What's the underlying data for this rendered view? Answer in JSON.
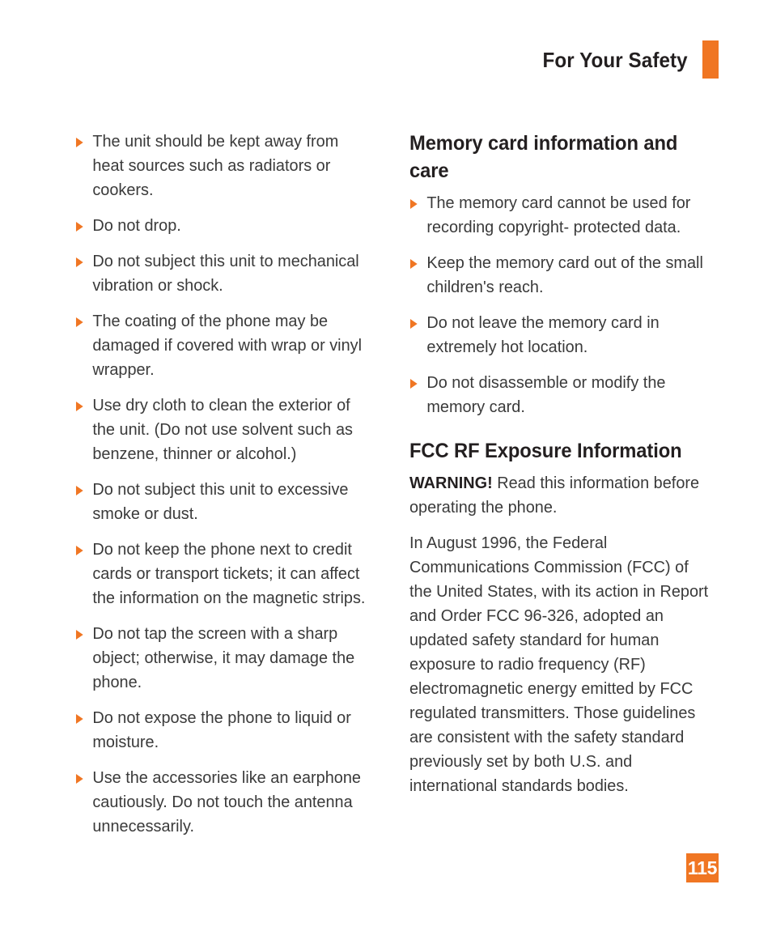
{
  "header": {
    "title": "For Your Safety",
    "accent_color": "#f07623"
  },
  "left_column": {
    "bullets": [
      "The unit should be kept away from heat sources such as radiators or cookers.",
      "Do not drop.",
      "Do not subject this unit to mechanical vibration or shock.",
      "The coating of the phone may be damaged if covered with wrap or vinyl wrapper.",
      "Use dry cloth to clean the exterior of the unit. (Do not use solvent such as benzene, thinner or alcohol.)",
      "Do not subject this unit to excessive smoke or dust.",
      "Do not keep the phone next to credit cards or transport tickets; it can affect the information on the magnetic strips.",
      "Do not tap the screen with a sharp object; otherwise, it may damage the phone.",
      "Do not expose the phone to liquid or moisture.",
      "Use the accessories like an earphone cautiously. Do not touch the antenna unnecessarily."
    ]
  },
  "right_column": {
    "memory_card": {
      "heading": "Memory card information and care",
      "bullets": [
        "The memory card cannot be used for recording copyright- protected data.",
        "Keep the memory card out of the small children's reach.",
        "Do not leave the memory card in extremely hot location.",
        "Do not disassemble or modify the memory card."
      ]
    },
    "fcc": {
      "heading": "FCC RF Exposure Information",
      "warning_label": "WARNING!",
      "warning_text": " Read this information before operating the phone.",
      "paragraph": "In August 1996, the Federal Communications Commission (FCC) of the United States, with its action in Report and Order FCC 96-326, adopted an updated safety standard for human exposure to radio frequency (RF) electromagnetic energy emitted by FCC regulated transmitters. Those guidelines are consistent with the safety standard previously set by both U.S. and international standards bodies."
    }
  },
  "footer": {
    "page_number": "115"
  }
}
